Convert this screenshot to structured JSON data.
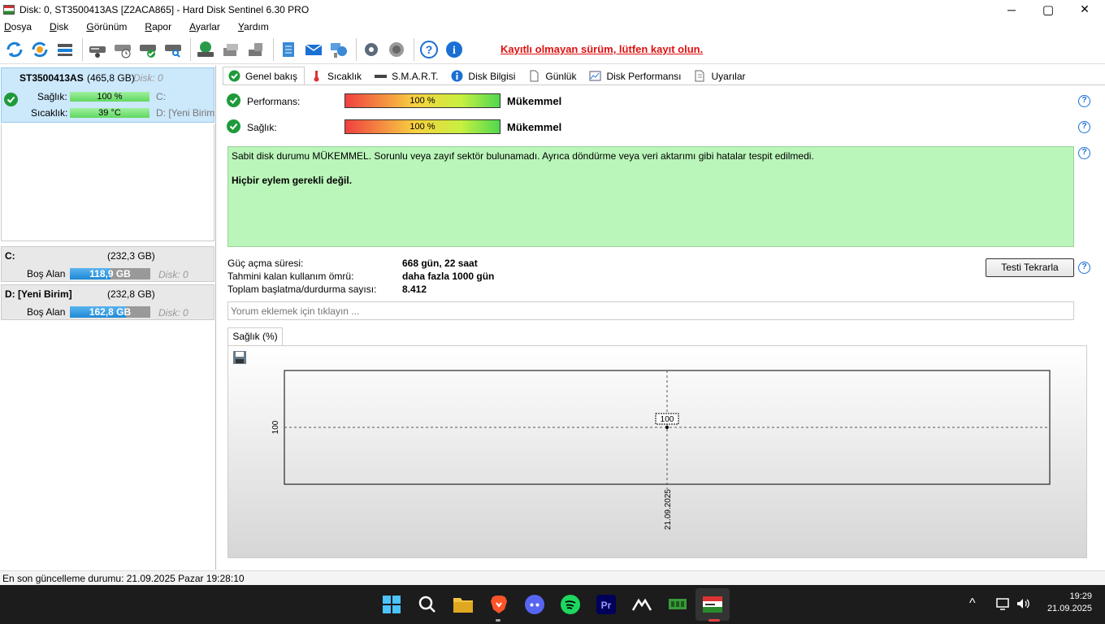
{
  "window": {
    "title": "Disk: 0, ST3500413AS [Z2ACA865]  -  Hard Disk Sentinel 6.30 PRO",
    "minimize": "─",
    "maximize": "▢",
    "close": "✕"
  },
  "menu": [
    {
      "first": "D",
      "rest": "osya"
    },
    {
      "first": "D",
      "rest": "isk"
    },
    {
      "first": "G",
      "rest": "örünüm"
    },
    {
      "first": "R",
      "rest": "apor"
    },
    {
      "first": "A",
      "rest": "yarlar"
    },
    {
      "first": "Y",
      "rest": "ardım"
    }
  ],
  "toolbar": {
    "unregistered": "Kayıtlı olmayan sürüm, lütfen kayıt olun."
  },
  "disk": {
    "name": "ST3500413AS",
    "size": "(465,8 GB)",
    "index": "Disk: 0",
    "health_label": "Sağlık:",
    "health_value": "100 %",
    "health_pct": 100,
    "temp_label": "Sıcaklık:",
    "temp_value": "39 °C",
    "drive_c": "C:",
    "drive_d": "D: [Yeni Birim"
  },
  "volumes": [
    {
      "name": "C:",
      "size": "(232,3 GB)",
      "free_label": "Boş Alan",
      "free_value": "118,9 GB",
      "free_pct": 51,
      "disk": "Disk: 0"
    },
    {
      "name": "D: [Yeni Birim]",
      "size": "(232,8 GB)",
      "free_label": "Boş Alan",
      "free_value": "162,8 GB",
      "free_pct": 70,
      "disk": "Disk: 0"
    }
  ],
  "tabs": [
    "Genel bakış",
    "Sıcaklık",
    "S.M.A.R.T.",
    "Disk Bilgisi",
    "Günlük",
    "Disk Performansı",
    "Uyarılar"
  ],
  "overview": {
    "performance_label": "Performans:",
    "performance_value": "100 %",
    "performance_rating": "Mükemmel",
    "health_label": "Sağlık:",
    "health_value": "100 %",
    "health_rating": "Mükemmel",
    "status_text": "Sabit disk durumu MÜKEMMEL. Sorunlu veya zayıf sektör bulunamadı. Ayrıca döndürme veya veri aktarımı gibi hatalar tespit edilmedi.",
    "action_text": "Hiçbir eylem gerekli değil.",
    "power_on_label": "Güç açma süresi:",
    "power_on_value": "668 gün, 22 saat",
    "lifetime_label": "Tahmini kalan kullanım ömrü:",
    "lifetime_value": "daha fazla 1000 gün",
    "startstop_label": "Toplam başlatma/durdurma sayısı:",
    "startstop_value": "8.412",
    "retest_button": "Testi Tekrarla",
    "comment_placeholder": "Yorum eklemek için tıklayın ..."
  },
  "chart_data": {
    "type": "line",
    "title": "Sağlık (%)",
    "x": [
      "21.09.2025"
    ],
    "series": [
      {
        "values": [
          100
        ]
      }
    ],
    "point_labels": [
      "100"
    ],
    "ytick_labels": [
      "100"
    ],
    "grid": true
  },
  "statusbar": {
    "text": "En son güncelleme durumu: 21.09.2025 Pazar 19:28:10"
  },
  "taskbar": {
    "time": "19:29",
    "date": "21.09.2025",
    "tray_arrow": "^"
  },
  "colors": {
    "selected_disk_bg": "#cce8fb",
    "status_ok_bg": "#baf5ba",
    "unregistered_red": "#e01010",
    "check_green": "#1f9a3a",
    "help_blue": "#1a6fd4"
  }
}
